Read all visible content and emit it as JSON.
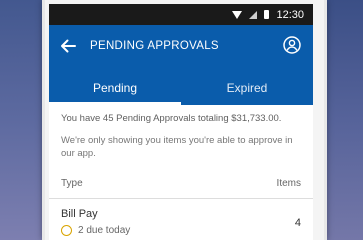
{
  "status_bar": {
    "time": "12:30",
    "icons": [
      "wifi-icon",
      "signal-icon",
      "battery-icon"
    ]
  },
  "app_bar": {
    "title": "PENDING APPROVALS",
    "back_icon": "back-arrow-icon",
    "profile_icon": "profile-icon"
  },
  "tabs": [
    {
      "label": "Pending",
      "active": true
    },
    {
      "label": "Expired",
      "active": false
    }
  ],
  "summary_text": "You have 45 Pending Approvals totaling $31,733.00.",
  "note_text": "We're only showing you items you're able to approve in our app.",
  "list": {
    "headers": {
      "type": "Type",
      "items": "Items"
    },
    "rows": [
      {
        "title": "Bill Pay",
        "subtitle": "2 due today",
        "count": "4"
      }
    ]
  },
  "colors": {
    "app_bar": "#0a5cab",
    "due_indicator": "#d9a400"
  }
}
